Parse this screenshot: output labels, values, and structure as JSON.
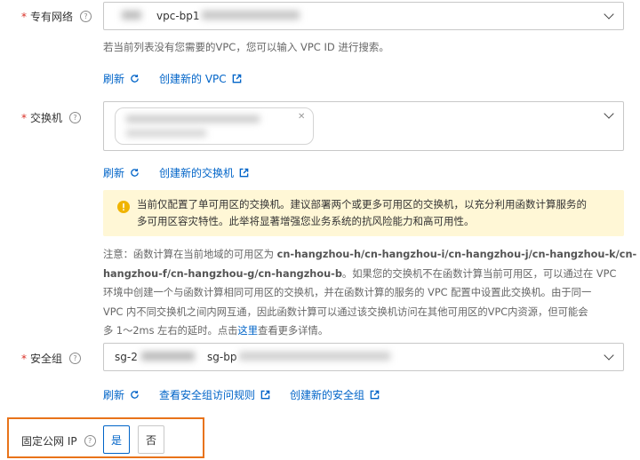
{
  "vpc": {
    "label": "专有网络",
    "selected_value": "vpc-bp1",
    "hint": "若当前列表没有您需要的VPC，您可以输入 VPC ID 进行搜索。",
    "refresh_label": "刷新",
    "create_label": "创建新的 VPC"
  },
  "vswitch": {
    "label": "交换机",
    "refresh_label": "刷新",
    "create_label": "创建新的交换机",
    "warning_line1": "当前仅配置了单可用区的交换机。建议部署两个或更多可用区的交换机，以充分利用函数计算服务的",
    "warning_line2": "多可用区容灾特性。此举将显著增强您业务系统的抗风险能力和高可用性。",
    "note": {
      "l1_pre": "注意：函数计算在当前地域的可用区为 ",
      "l1_bold": "cn-hangzhou-h/cn-hangzhou-i/cn-hangzhou-j/cn-hangzhou-k/cn-",
      "l2_bold": "hangzhou-f/cn-hangzhou-g/cn-hangzhou-b",
      "l2_post": "。如果您的交换机不在函数计算当前可用区，可以通过在 VPC",
      "l3": "环境中创建一个与函数计算相同可用区的交换机，并在函数计算的服务的 VPC 配置中设置此交换机。由于同一",
      "l4": "VPC 内不同交换机之间内网互通，因此函数计算可以通过该交换机访问在其他可用区的VPC内资源，但可能会",
      "l5_pre": "多 1～2ms 左右的延时。点击",
      "l5_link": "这里",
      "l5_post": "查看更多详情。"
    }
  },
  "security_group": {
    "label": "安全组",
    "value_prefix_1": "sg-2",
    "value_prefix_2": "sg-bp",
    "refresh_label": "刷新",
    "view_rules_label": "查看安全组访问规则",
    "create_label": "创建新的安全组"
  },
  "fixed_ip": {
    "label": "固定公网 IP",
    "yes_label": "是",
    "no_label": "否",
    "selected": "是",
    "highlight_color": "#e8731a"
  },
  "colors": {
    "link": "#0064c8",
    "required": "#d93026",
    "warning_bg": "#fff7d6",
    "warning_icon": "#f0b400"
  },
  "icons": {
    "help": "question-circle-icon",
    "refresh": "refresh-icon",
    "external": "external-link-icon",
    "dropdown": "chevron-down-icon",
    "warning": "exclamation-circle-icon"
  }
}
